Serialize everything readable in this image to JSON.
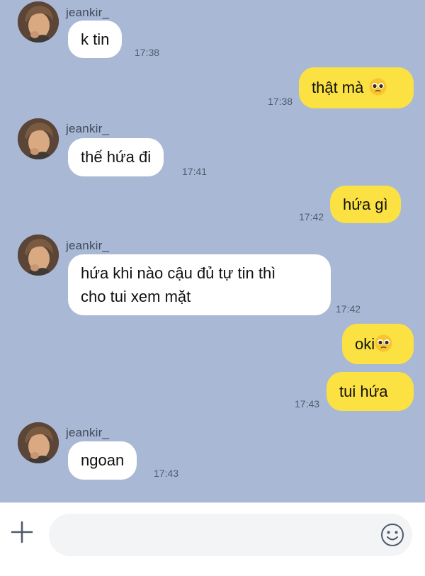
{
  "contact": {
    "name": "jeankir_"
  },
  "messages": [
    {
      "dir": "in",
      "text": "k tin",
      "time": "17:38"
    },
    {
      "dir": "out",
      "text": "thật mà",
      "emoji": "pleading-face-emoji",
      "time": "17:38"
    },
    {
      "dir": "in",
      "text": "thế hứa đi",
      "time": "17:41"
    },
    {
      "dir": "out",
      "text": "hứa gì",
      "time": "17:42"
    },
    {
      "dir": "in",
      "lines": [
        "hứa khi nào cậu đủ tự tin thì",
        "cho tui xem mặt"
      ],
      "time": "17:42"
    },
    {
      "dir": "out",
      "text": "oki",
      "emoji": "pleading-face-emoji",
      "time": ""
    },
    {
      "dir": "out",
      "text": "tui hứa",
      "time": "17:43"
    },
    {
      "dir": "in",
      "text": "ngoan",
      "time": "17:43"
    }
  ],
  "composer": {
    "placeholder": "",
    "plus_icon": "plus-icon",
    "sticker_icon": "smiley-icon"
  },
  "colors": {
    "background": "#a9b9d5",
    "outgoing_bubble": "#fbe142",
    "incoming_bubble": "#ffffff"
  }
}
